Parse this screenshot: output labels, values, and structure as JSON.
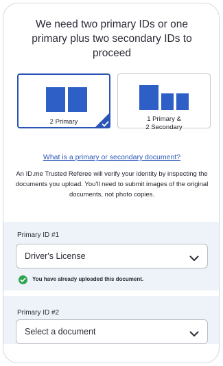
{
  "headline": "We need two primary IDs or one primary plus two secondary IDs to proceed",
  "options": [
    {
      "label": "2 Primary",
      "selected": true
    },
    {
      "label_line1": "1 Primary &",
      "label_line2": "2 Secondary",
      "selected": false
    }
  ],
  "help_link": "What is a primary or secondary document?",
  "info_text": "An ID.me Trusted Referee will verify your identity by inspecting the documents you upload. You'll need to submit images of the original documents, not photo copies.",
  "primary1": {
    "label": "Primary ID #1",
    "value": "Driver's License",
    "status": "You have already uploaded this document."
  },
  "primary2": {
    "label": "Primary ID #2",
    "placeholder": "Select a document"
  },
  "colors": {
    "accent": "#2a55b6",
    "block": "#2d5fc7",
    "success": "#2fa550",
    "section_bg": "#eef3f9"
  }
}
